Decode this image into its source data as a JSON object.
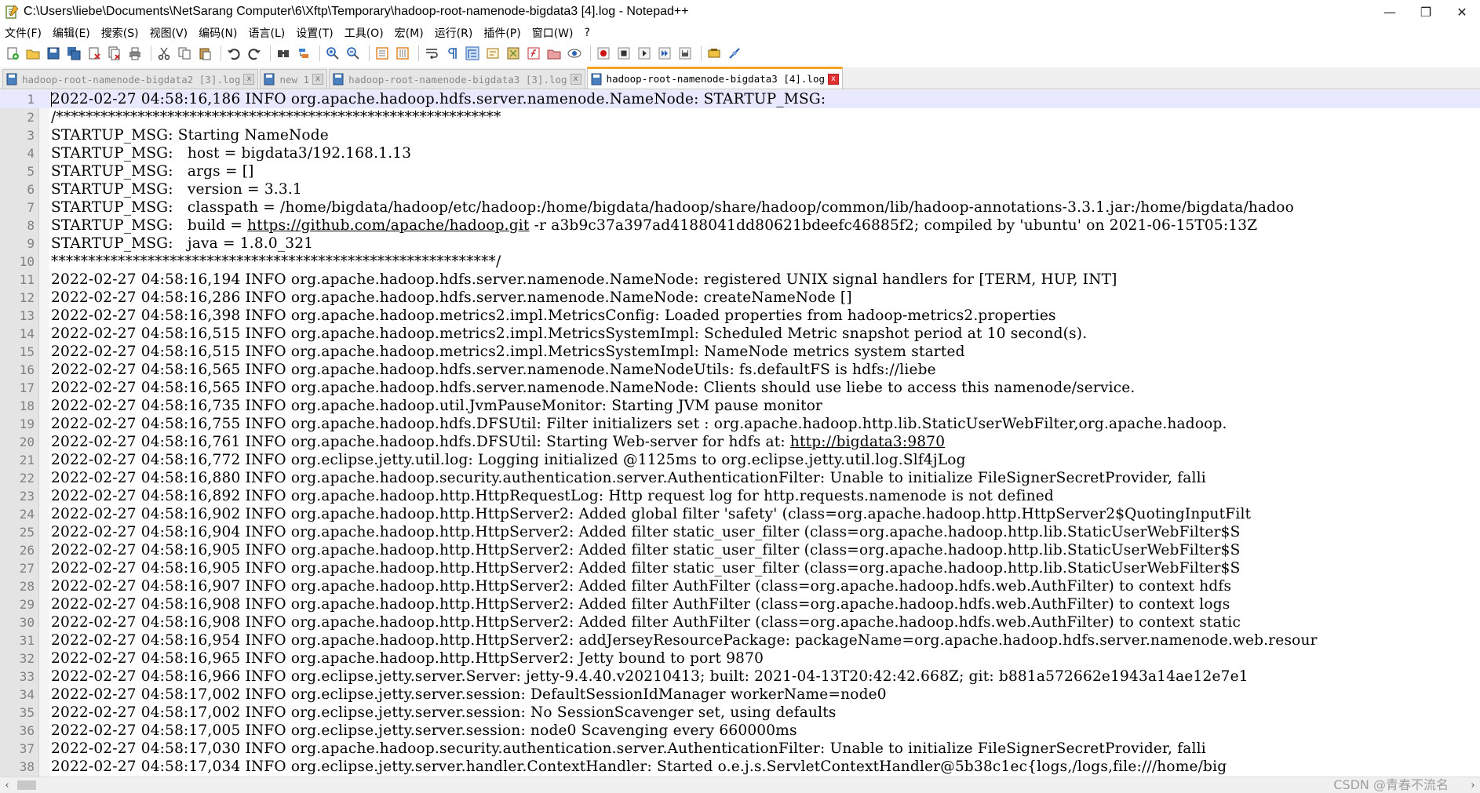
{
  "window": {
    "title": "C:\\Users\\liebe\\Documents\\NetSarang Computer\\6\\Xftp\\Temporary\\hadoop-root-namenode-bigdata3 [4].log - Notepad++",
    "minimize": "—",
    "restore": "❐",
    "close": "✕"
  },
  "menu": [
    "文件(F)",
    "编辑(E)",
    "搜索(S)",
    "视图(V)",
    "编码(N)",
    "语言(L)",
    "设置(T)",
    "工具(O)",
    "宏(M)",
    "运行(R)",
    "插件(P)",
    "窗口(W)",
    "?"
  ],
  "tabs": [
    {
      "label": "hadoop-root-namenode-bigdata2 [3].log",
      "active": false
    },
    {
      "label": "new 1",
      "active": false
    },
    {
      "label": "hadoop-root-namenode-bigdata3 [3].log",
      "active": false
    },
    {
      "label": "hadoop-root-namenode-bigdata3 [4].log",
      "active": true
    }
  ],
  "tab_close": "x",
  "lines": [
    {
      "n": "1",
      "text": "2022-02-27 04:58:16,186 INFO org.apache.hadoop.hdfs.server.namenode.NameNode: STARTUP_MSG:"
    },
    {
      "n": "2",
      "text": "/************************************************************"
    },
    {
      "n": "3",
      "text": "STARTUP_MSG: Starting NameNode"
    },
    {
      "n": "4",
      "text": "STARTUP_MSG:   host = bigdata3/192.168.1.13"
    },
    {
      "n": "5",
      "text": "STARTUP_MSG:   args = []"
    },
    {
      "n": "6",
      "text": "STARTUP_MSG:   version = 3.3.1"
    },
    {
      "n": "7",
      "text": "STARTUP_MSG:   classpath = /home/bigdata/hadoop/etc/hadoop:/home/bigdata/hadoop/share/hadoop/common/lib/hadoop-annotations-3.3.1.jar:/home/bigdata/hadoo"
    },
    {
      "n": "8",
      "pre": "STARTUP_MSG:   build = ",
      "link": "https://github.com/apache/hadoop.git",
      "post": " -r a3b9c37a397ad4188041dd80621bdeefc46885f2; compiled by 'ubuntu' on 2021-06-15T05:13Z"
    },
    {
      "n": "9",
      "text": "STARTUP_MSG:   java = 1.8.0_321"
    },
    {
      "n": "10",
      "text": "************************************************************/"
    },
    {
      "n": "11",
      "text": "2022-02-27 04:58:16,194 INFO org.apache.hadoop.hdfs.server.namenode.NameNode: registered UNIX signal handlers for [TERM, HUP, INT]"
    },
    {
      "n": "12",
      "text": "2022-02-27 04:58:16,286 INFO org.apache.hadoop.hdfs.server.namenode.NameNode: createNameNode []"
    },
    {
      "n": "13",
      "text": "2022-02-27 04:58:16,398 INFO org.apache.hadoop.metrics2.impl.MetricsConfig: Loaded properties from hadoop-metrics2.properties"
    },
    {
      "n": "14",
      "text": "2022-02-27 04:58:16,515 INFO org.apache.hadoop.metrics2.impl.MetricsSystemImpl: Scheduled Metric snapshot period at 10 second(s)."
    },
    {
      "n": "15",
      "text": "2022-02-27 04:58:16,515 INFO org.apache.hadoop.metrics2.impl.MetricsSystemImpl: NameNode metrics system started"
    },
    {
      "n": "16",
      "text": "2022-02-27 04:58:16,565 INFO org.apache.hadoop.hdfs.server.namenode.NameNodeUtils: fs.defaultFS is hdfs://liebe"
    },
    {
      "n": "17",
      "text": "2022-02-27 04:58:16,565 INFO org.apache.hadoop.hdfs.server.namenode.NameNode: Clients should use liebe to access this namenode/service."
    },
    {
      "n": "18",
      "text": "2022-02-27 04:58:16,735 INFO org.apache.hadoop.util.JvmPauseMonitor: Starting JVM pause monitor"
    },
    {
      "n": "19",
      "text": "2022-02-27 04:58:16,755 INFO org.apache.hadoop.hdfs.DFSUtil: Filter initializers set : org.apache.hadoop.http.lib.StaticUserWebFilter,org.apache.hadoop."
    },
    {
      "n": "20",
      "pre": "2022-02-27 04:58:16,761 INFO org.apache.hadoop.hdfs.DFSUtil: Starting Web-server for hdfs at: ",
      "link": "http://bigdata3:9870",
      "post": ""
    },
    {
      "n": "21",
      "text": "2022-02-27 04:58:16,772 INFO org.eclipse.jetty.util.log: Logging initialized @1125ms to org.eclipse.jetty.util.log.Slf4jLog"
    },
    {
      "n": "22",
      "text": "2022-02-27 04:58:16,880 INFO org.apache.hadoop.security.authentication.server.AuthenticationFilter: Unable to initialize FileSignerSecretProvider, falli"
    },
    {
      "n": "23",
      "text": "2022-02-27 04:58:16,892 INFO org.apache.hadoop.http.HttpRequestLog: Http request log for http.requests.namenode is not defined"
    },
    {
      "n": "24",
      "text": "2022-02-27 04:58:16,902 INFO org.apache.hadoop.http.HttpServer2: Added global filter 'safety' (class=org.apache.hadoop.http.HttpServer2$QuotingInputFilt"
    },
    {
      "n": "25",
      "text": "2022-02-27 04:58:16,904 INFO org.apache.hadoop.http.HttpServer2: Added filter static_user_filter (class=org.apache.hadoop.http.lib.StaticUserWebFilter$S"
    },
    {
      "n": "26",
      "text": "2022-02-27 04:58:16,905 INFO org.apache.hadoop.http.HttpServer2: Added filter static_user_filter (class=org.apache.hadoop.http.lib.StaticUserWebFilter$S"
    },
    {
      "n": "27",
      "text": "2022-02-27 04:58:16,905 INFO org.apache.hadoop.http.HttpServer2: Added filter static_user_filter (class=org.apache.hadoop.http.lib.StaticUserWebFilter$S"
    },
    {
      "n": "28",
      "text": "2022-02-27 04:58:16,907 INFO org.apache.hadoop.http.HttpServer2: Added filter AuthFilter (class=org.apache.hadoop.hdfs.web.AuthFilter) to context hdfs"
    },
    {
      "n": "29",
      "text": "2022-02-27 04:58:16,908 INFO org.apache.hadoop.http.HttpServer2: Added filter AuthFilter (class=org.apache.hadoop.hdfs.web.AuthFilter) to context logs"
    },
    {
      "n": "30",
      "text": "2022-02-27 04:58:16,908 INFO org.apache.hadoop.http.HttpServer2: Added filter AuthFilter (class=org.apache.hadoop.hdfs.web.AuthFilter) to context static"
    },
    {
      "n": "31",
      "text": "2022-02-27 04:58:16,954 INFO org.apache.hadoop.http.HttpServer2: addJerseyResourcePackage: packageName=org.apache.hadoop.hdfs.server.namenode.web.resour"
    },
    {
      "n": "32",
      "text": "2022-02-27 04:58:16,965 INFO org.apache.hadoop.http.HttpServer2: Jetty bound to port 9870"
    },
    {
      "n": "33",
      "text": "2022-02-27 04:58:16,966 INFO org.eclipse.jetty.server.Server: jetty-9.4.40.v20210413; built: 2021-04-13T20:42:42.668Z; git: b881a572662e1943a14ae12e7e1"
    },
    {
      "n": "34",
      "text": "2022-02-27 04:58:17,002 INFO org.eclipse.jetty.server.session: DefaultSessionIdManager workerName=node0"
    },
    {
      "n": "35",
      "text": "2022-02-27 04:58:17,002 INFO org.eclipse.jetty.server.session: No SessionScavenger set, using defaults"
    },
    {
      "n": "36",
      "text": "2022-02-27 04:58:17,005 INFO org.eclipse.jetty.server.session: node0 Scavenging every 660000ms"
    },
    {
      "n": "37",
      "text": "2022-02-27 04:58:17,030 INFO org.apache.hadoop.security.authentication.server.AuthenticationFilter: Unable to initialize FileSignerSecretProvider, falli"
    },
    {
      "n": "38",
      "text": "2022-02-27 04:58:17,034 INFO org.eclipse.jetty.server.handler.ContextHandler: Started o.e.j.s.ServletContextHandler@5b38c1ec{logs,/logs,file:///home/big"
    }
  ],
  "scroll": {
    "left": "‹",
    "right": "›"
  },
  "watermark": "CSDN @青春不流名"
}
